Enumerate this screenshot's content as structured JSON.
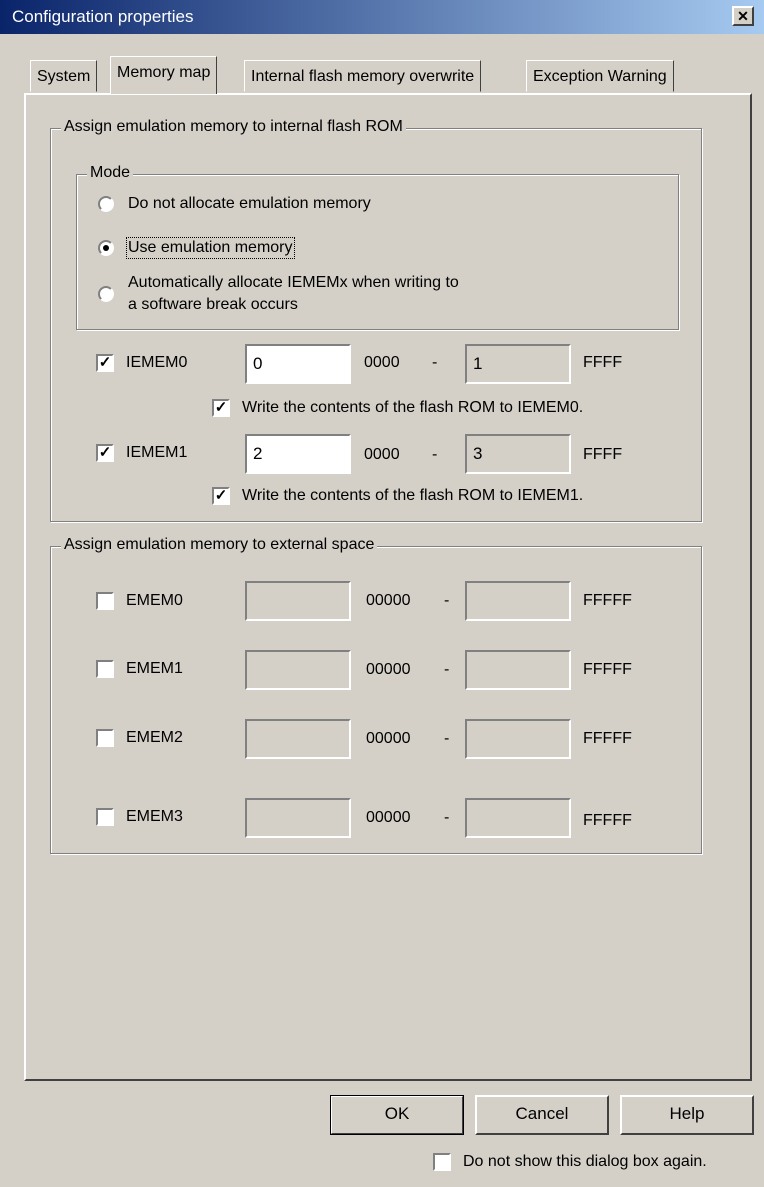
{
  "window": {
    "title": "Configuration properties",
    "close_glyph": "✕"
  },
  "tabs": [
    {
      "label": "System"
    },
    {
      "label": "Memory map"
    },
    {
      "label": "Internal flash memory overwrite"
    },
    {
      "label": "Exception Warning"
    }
  ],
  "internal": {
    "legend": "Assign emulation memory to internal flash ROM",
    "mode_legend": "Mode",
    "radios": [
      {
        "label": "Do not allocate emulation memory",
        "selected": false
      },
      {
        "label": "Use emulation memory",
        "selected": true
      },
      {
        "label_line1": "Automatically allocate IEMEMx when writing to",
        "label_line2": "a software break occurs",
        "selected": false
      }
    ],
    "rows": [
      {
        "label": "IEMEM0",
        "checked": true,
        "start": "0",
        "mid": "0000",
        "dash": "-",
        "end": "1",
        "suffix": "FFFF",
        "write_label": "Write the contents of the flash ROM to IEMEM0.",
        "write_checked": true
      },
      {
        "label": "IEMEM1",
        "checked": true,
        "start": "2",
        "mid": "0000",
        "dash": "-",
        "end": "3",
        "suffix": "FFFF",
        "write_label": "Write the contents of the flash ROM to IEMEM1.",
        "write_checked": true
      }
    ]
  },
  "external": {
    "legend": "Assign emulation memory to external space",
    "rows": [
      {
        "label": "EMEM0",
        "checked": false,
        "mid": "00000",
        "dash": "-",
        "suffix": "FFFFF"
      },
      {
        "label": "EMEM1",
        "checked": false,
        "mid": "00000",
        "dash": "-",
        "suffix": "FFFFF"
      },
      {
        "label": "EMEM2",
        "checked": false,
        "mid": "00000",
        "dash": "-",
        "suffix": "FFFFF"
      },
      {
        "label": "EMEM3",
        "checked": false,
        "mid": "00000",
        "dash": "-",
        "suffix": "FFFFF"
      }
    ]
  },
  "buttons": {
    "ok": "OK",
    "cancel": "Cancel",
    "help": "Help"
  },
  "dont_show": {
    "label": "Do not show this dialog box again.",
    "checked": false
  },
  "check_glyph": "✓"
}
